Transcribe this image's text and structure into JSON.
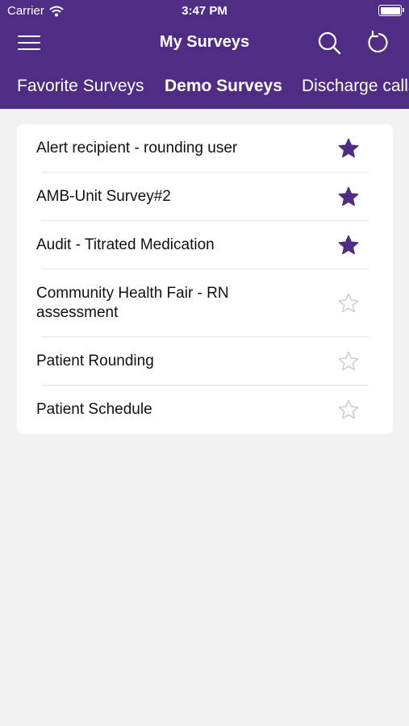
{
  "status_bar": {
    "carrier": "Carrier",
    "time": "3:47 PM"
  },
  "nav": {
    "title": "My Surveys"
  },
  "tabs": [
    {
      "label": "Favorite Surveys",
      "active": false
    },
    {
      "label": "Demo Surveys",
      "active": true
    },
    {
      "label": "Discharge calls",
      "active": false
    }
  ],
  "surveys": [
    {
      "title": "Alert recipient - rounding user",
      "favorite": true
    },
    {
      "title": "AMB-Unit Survey#2",
      "favorite": true
    },
    {
      "title": "Audit - Titrated Medication",
      "favorite": true
    },
    {
      "title": "Community Health Fair - RN assessment",
      "favorite": false
    },
    {
      "title": "Patient Rounding",
      "favorite": false
    },
    {
      "title": "Patient Schedule",
      "favorite": false
    }
  ],
  "colors": {
    "brand": "#4f2d84",
    "star_filled": "#4f2d84",
    "star_outline": "#cccccc",
    "background": "#f2f2f2"
  },
  "icons": {
    "menu": "hamburger-menu-icon",
    "search": "search-icon",
    "refresh": "refresh-icon",
    "star_filled": "star-filled-icon",
    "star_outline": "star-outline-icon",
    "wifi": "wifi-icon",
    "battery": "battery-icon"
  }
}
